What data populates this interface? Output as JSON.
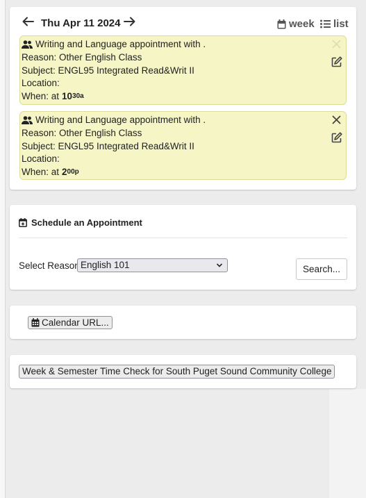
{
  "calendar": {
    "date_label": "Thu Apr 11 2024",
    "prev_icon": "arrow-left-icon",
    "next_icon": "arrow-right-icon",
    "week_label": "week",
    "list_label": "list",
    "appointments": [
      {
        "title": "Writing and Language appointment with .",
        "reason": "Reason: Other English Class",
        "subject": "Subject: ENGL95 Integrated Read&Writ II",
        "location": "Location:",
        "when_prefix": "When: at",
        "time_hour": "10",
        "time_suffix": "30a"
      },
      {
        "title": "Writing and Language appointment with .",
        "reason": "Reason: Other English Class",
        "subject": "Subject: ENGL95 Integrated Read&Writ II",
        "location": "Location:",
        "when_prefix": "When: at",
        "time_hour": "2",
        "time_suffix": "00p"
      }
    ]
  },
  "schedule": {
    "title": "Schedule an Appointment",
    "select_label": "Select Reason",
    "selected_reason": "English 101",
    "search_label": "Search..."
  },
  "calendar_url": {
    "button_label": "Calendar URL..."
  },
  "time_check": {
    "button_label": "Week & Semester Time Check for South Puget Sound Community College"
  },
  "colors": {
    "appointment_bg": "#f5f5c5",
    "page_bg": "#ececec"
  }
}
